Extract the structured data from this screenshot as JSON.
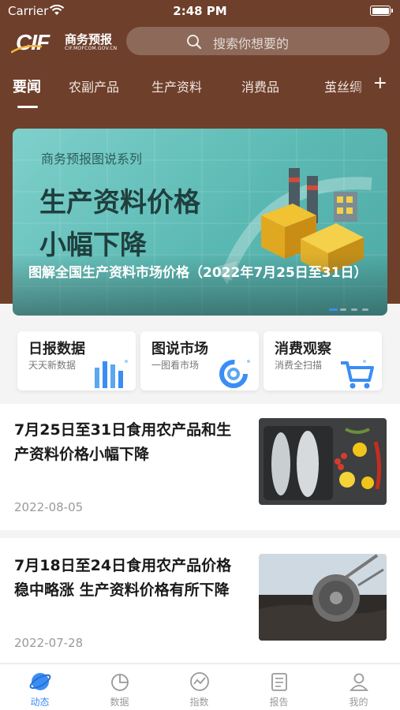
{
  "status_bar": {
    "carrier": "Carrier",
    "time": "2:48 PM"
  },
  "header": {
    "logo_mark": "CIF",
    "logo_cn": "商务预报",
    "logo_url": "CIF.MOFCOM.GOV.CN",
    "search_placeholder": "搜索你想要的"
  },
  "tabs": [
    {
      "label": "要闻",
      "active": true
    },
    {
      "label": "农副产品"
    },
    {
      "label": "生产资料"
    },
    {
      "label": "消费品"
    },
    {
      "label": "茧丝绸"
    }
  ],
  "tab_add": "+",
  "banner": {
    "series": "商务预报图说系列",
    "headline_line1": "生产资料价格",
    "headline_line2": "小幅下降",
    "caption": "图解全国生产资料市场价格（2022年7月25日至31日）",
    "slide_count": 4,
    "active_slide": 1
  },
  "quick_entries": [
    {
      "title": "日报数据",
      "subtitle": "天天新数据",
      "icon": "bar-chart-icon"
    },
    {
      "title": "图说市场",
      "subtitle": "一图看市场",
      "icon": "ring-chart-icon"
    },
    {
      "title": "消费观察",
      "subtitle": "消费全扫描",
      "icon": "shopping-cart-icon"
    }
  ],
  "news": [
    {
      "title": "7月25日至31日食用农产品和生产资料价格小幅下降",
      "date": "2022-08-05",
      "thumb": "fish-vegetables-photo"
    },
    {
      "title": "7月18日至24日食用农产品价格稳中略涨  生产资料价格有所下降",
      "date": "2022-07-28",
      "thumb": "mining-wheel-photo"
    }
  ],
  "bottom_nav": [
    {
      "label": "动态",
      "icon": "globe-icon",
      "active": true
    },
    {
      "label": "数据",
      "icon": "pie-chart-icon"
    },
    {
      "label": "指数",
      "icon": "trend-icon"
    },
    {
      "label": "报告",
      "icon": "document-icon"
    },
    {
      "label": "我的",
      "icon": "user-icon"
    }
  ],
  "colors": {
    "header_brown": "#6e3f2b",
    "accent_blue": "#3a8df5",
    "banner_teal": "#5bb9b3"
  }
}
